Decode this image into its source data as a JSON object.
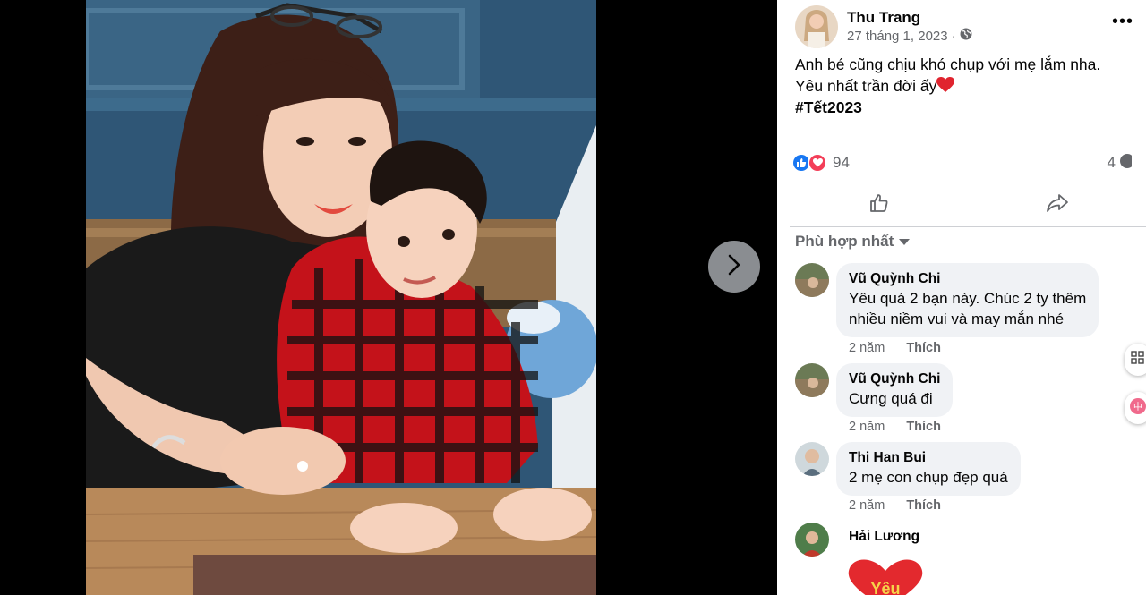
{
  "post": {
    "author": "Thu Trang",
    "date": "27 tháng 1, 2023 ·",
    "caption_line1": "Anh bé cũng chịu khó chụp với mẹ lắm nha.",
    "caption_line2": "Yêu nhất trần đời ấy",
    "hashtag": "#Tết2023",
    "reaction_count": "94",
    "share_count": "4",
    "privacy_icon": "globe-icon",
    "more_icon": "more-dots-icon"
  },
  "actions": {
    "like_icon": "thumbs-up-icon",
    "share_icon": "share-arrow-icon"
  },
  "sort_label": "Phù hợp nhất",
  "comments": [
    {
      "name": "Vũ Quỳnh Chi",
      "line1": "Yêu quá 2 bạn này. Chúc 2 ty thêm",
      "line2": "nhiều niềm vui và may mắn nhé",
      "time": "2 năm",
      "like": "Thích"
    },
    {
      "name": "Vũ Quỳnh Chi",
      "line1": "Cưng quá đi",
      "time": "2 năm",
      "like": "Thích"
    },
    {
      "name": "Thi Han Bui",
      "line1": "2 mẹ con chụp đẹp quá",
      "time": "2 năm",
      "like": "Thích"
    },
    {
      "name": "Hải Lương",
      "sticker_text": "Yêu"
    }
  ],
  "colors": {
    "accent": "#1877f2",
    "love": "#f33e58",
    "bubble": "#f0f2f5",
    "secondary_text": "#65676b"
  }
}
